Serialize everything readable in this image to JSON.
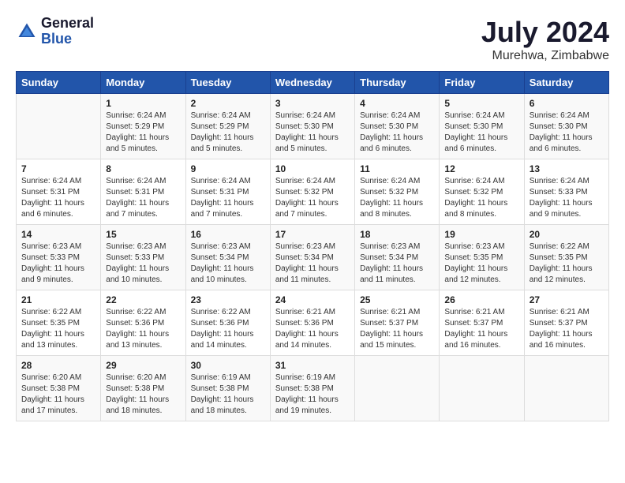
{
  "header": {
    "logo_general": "General",
    "logo_blue": "Blue",
    "month_title": "July 2024",
    "location": "Murehwa, Zimbabwe"
  },
  "days_of_week": [
    "Sunday",
    "Monday",
    "Tuesday",
    "Wednesday",
    "Thursday",
    "Friday",
    "Saturday"
  ],
  "weeks": [
    [
      {
        "day": "",
        "sunrise": "",
        "sunset": "",
        "daylight": ""
      },
      {
        "day": "1",
        "sunrise": "Sunrise: 6:24 AM",
        "sunset": "Sunset: 5:29 PM",
        "daylight": "Daylight: 11 hours and 5 minutes."
      },
      {
        "day": "2",
        "sunrise": "Sunrise: 6:24 AM",
        "sunset": "Sunset: 5:29 PM",
        "daylight": "Daylight: 11 hours and 5 minutes."
      },
      {
        "day": "3",
        "sunrise": "Sunrise: 6:24 AM",
        "sunset": "Sunset: 5:30 PM",
        "daylight": "Daylight: 11 hours and 5 minutes."
      },
      {
        "day": "4",
        "sunrise": "Sunrise: 6:24 AM",
        "sunset": "Sunset: 5:30 PM",
        "daylight": "Daylight: 11 hours and 6 minutes."
      },
      {
        "day": "5",
        "sunrise": "Sunrise: 6:24 AM",
        "sunset": "Sunset: 5:30 PM",
        "daylight": "Daylight: 11 hours and 6 minutes."
      },
      {
        "day": "6",
        "sunrise": "Sunrise: 6:24 AM",
        "sunset": "Sunset: 5:30 PM",
        "daylight": "Daylight: 11 hours and 6 minutes."
      }
    ],
    [
      {
        "day": "7",
        "sunrise": "Sunrise: 6:24 AM",
        "sunset": "Sunset: 5:31 PM",
        "daylight": "Daylight: 11 hours and 6 minutes."
      },
      {
        "day": "8",
        "sunrise": "Sunrise: 6:24 AM",
        "sunset": "Sunset: 5:31 PM",
        "daylight": "Daylight: 11 hours and 7 minutes."
      },
      {
        "day": "9",
        "sunrise": "Sunrise: 6:24 AM",
        "sunset": "Sunset: 5:31 PM",
        "daylight": "Daylight: 11 hours and 7 minutes."
      },
      {
        "day": "10",
        "sunrise": "Sunrise: 6:24 AM",
        "sunset": "Sunset: 5:32 PM",
        "daylight": "Daylight: 11 hours and 7 minutes."
      },
      {
        "day": "11",
        "sunrise": "Sunrise: 6:24 AM",
        "sunset": "Sunset: 5:32 PM",
        "daylight": "Daylight: 11 hours and 8 minutes."
      },
      {
        "day": "12",
        "sunrise": "Sunrise: 6:24 AM",
        "sunset": "Sunset: 5:32 PM",
        "daylight": "Daylight: 11 hours and 8 minutes."
      },
      {
        "day": "13",
        "sunrise": "Sunrise: 6:24 AM",
        "sunset": "Sunset: 5:33 PM",
        "daylight": "Daylight: 11 hours and 9 minutes."
      }
    ],
    [
      {
        "day": "14",
        "sunrise": "Sunrise: 6:23 AM",
        "sunset": "Sunset: 5:33 PM",
        "daylight": "Daylight: 11 hours and 9 minutes."
      },
      {
        "day": "15",
        "sunrise": "Sunrise: 6:23 AM",
        "sunset": "Sunset: 5:33 PM",
        "daylight": "Daylight: 11 hours and 10 minutes."
      },
      {
        "day": "16",
        "sunrise": "Sunrise: 6:23 AM",
        "sunset": "Sunset: 5:34 PM",
        "daylight": "Daylight: 11 hours and 10 minutes."
      },
      {
        "day": "17",
        "sunrise": "Sunrise: 6:23 AM",
        "sunset": "Sunset: 5:34 PM",
        "daylight": "Daylight: 11 hours and 11 minutes."
      },
      {
        "day": "18",
        "sunrise": "Sunrise: 6:23 AM",
        "sunset": "Sunset: 5:34 PM",
        "daylight": "Daylight: 11 hours and 11 minutes."
      },
      {
        "day": "19",
        "sunrise": "Sunrise: 6:23 AM",
        "sunset": "Sunset: 5:35 PM",
        "daylight": "Daylight: 11 hours and 12 minutes."
      },
      {
        "day": "20",
        "sunrise": "Sunrise: 6:22 AM",
        "sunset": "Sunset: 5:35 PM",
        "daylight": "Daylight: 11 hours and 12 minutes."
      }
    ],
    [
      {
        "day": "21",
        "sunrise": "Sunrise: 6:22 AM",
        "sunset": "Sunset: 5:35 PM",
        "daylight": "Daylight: 11 hours and 13 minutes."
      },
      {
        "day": "22",
        "sunrise": "Sunrise: 6:22 AM",
        "sunset": "Sunset: 5:36 PM",
        "daylight": "Daylight: 11 hours and 13 minutes."
      },
      {
        "day": "23",
        "sunrise": "Sunrise: 6:22 AM",
        "sunset": "Sunset: 5:36 PM",
        "daylight": "Daylight: 11 hours and 14 minutes."
      },
      {
        "day": "24",
        "sunrise": "Sunrise: 6:21 AM",
        "sunset": "Sunset: 5:36 PM",
        "daylight": "Daylight: 11 hours and 14 minutes."
      },
      {
        "day": "25",
        "sunrise": "Sunrise: 6:21 AM",
        "sunset": "Sunset: 5:37 PM",
        "daylight": "Daylight: 11 hours and 15 minutes."
      },
      {
        "day": "26",
        "sunrise": "Sunrise: 6:21 AM",
        "sunset": "Sunset: 5:37 PM",
        "daylight": "Daylight: 11 hours and 16 minutes."
      },
      {
        "day": "27",
        "sunrise": "Sunrise: 6:21 AM",
        "sunset": "Sunset: 5:37 PM",
        "daylight": "Daylight: 11 hours and 16 minutes."
      }
    ],
    [
      {
        "day": "28",
        "sunrise": "Sunrise: 6:20 AM",
        "sunset": "Sunset: 5:38 PM",
        "daylight": "Daylight: 11 hours and 17 minutes."
      },
      {
        "day": "29",
        "sunrise": "Sunrise: 6:20 AM",
        "sunset": "Sunset: 5:38 PM",
        "daylight": "Daylight: 11 hours and 18 minutes."
      },
      {
        "day": "30",
        "sunrise": "Sunrise: 6:19 AM",
        "sunset": "Sunset: 5:38 PM",
        "daylight": "Daylight: 11 hours and 18 minutes."
      },
      {
        "day": "31",
        "sunrise": "Sunrise: 6:19 AM",
        "sunset": "Sunset: 5:38 PM",
        "daylight": "Daylight: 11 hours and 19 minutes."
      },
      {
        "day": "",
        "sunrise": "",
        "sunset": "",
        "daylight": ""
      },
      {
        "day": "",
        "sunrise": "",
        "sunset": "",
        "daylight": ""
      },
      {
        "day": "",
        "sunrise": "",
        "sunset": "",
        "daylight": ""
      }
    ]
  ]
}
